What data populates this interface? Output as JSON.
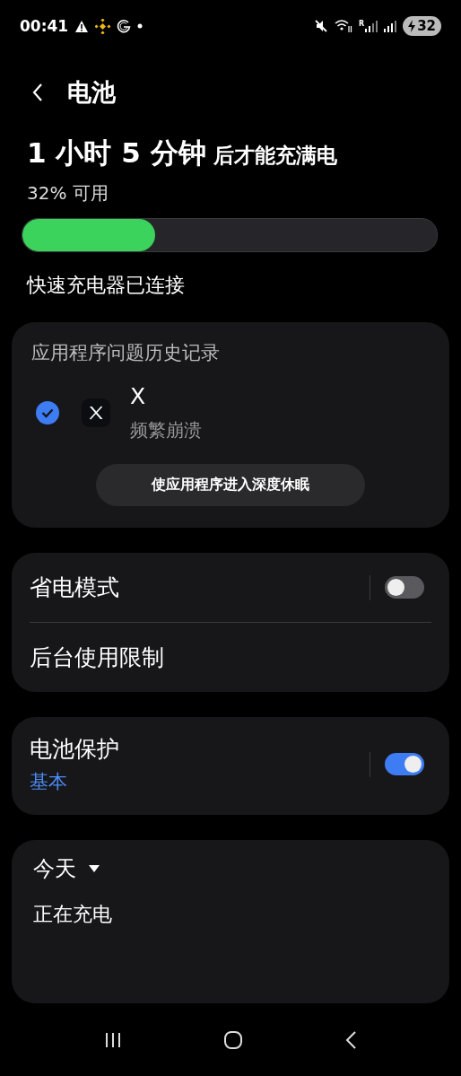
{
  "status_bar": {
    "time": "00:41",
    "roaming_label": "R",
    "battery_percent": "32",
    "charging": true
  },
  "header": {
    "title": "电池"
  },
  "charge": {
    "time_remaining": "1 小时 5 分钟",
    "suffix": "后才能充满电",
    "available": "32% 可用",
    "level": 0.32,
    "charger_status": "快速充电器已连接"
  },
  "app_issues": {
    "title": "应用程序问题历史记录",
    "apps": [
      {
        "name": "X",
        "issue": "频繁崩溃",
        "checked": true
      }
    ],
    "action": "使应用程序进入深度休眠"
  },
  "settings": [
    {
      "label": "省电模式",
      "on": false
    },
    {
      "label": "后台使用限制"
    }
  ],
  "protection": {
    "label": "电池保护",
    "value": "基本",
    "on": true
  },
  "usage": {
    "period": "今天",
    "status": "正在充电"
  }
}
